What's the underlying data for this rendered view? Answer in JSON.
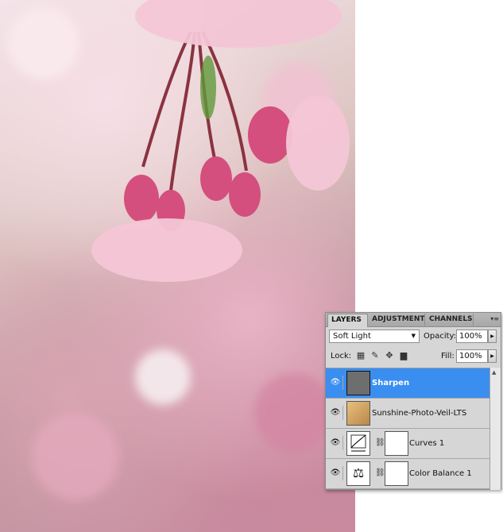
{
  "panel": {
    "tabs": [
      {
        "label": "LAYERS"
      },
      {
        "label": "ADJUSTMENTS"
      },
      {
        "label": "CHANNELS"
      }
    ],
    "blend_mode": "Soft Light",
    "opacity_label": "Opacity:",
    "opacity_value": "100%",
    "lock_label": "Lock:",
    "fill_label": "Fill:",
    "fill_value": "100%",
    "layers": [
      {
        "name": "Sharpen",
        "selected": true
      },
      {
        "name": "Sunshine-Photo-Veil-LTS",
        "selected": false
      },
      {
        "name": "Curves 1",
        "selected": false
      },
      {
        "name": "Color Balance 1",
        "selected": false
      }
    ]
  }
}
